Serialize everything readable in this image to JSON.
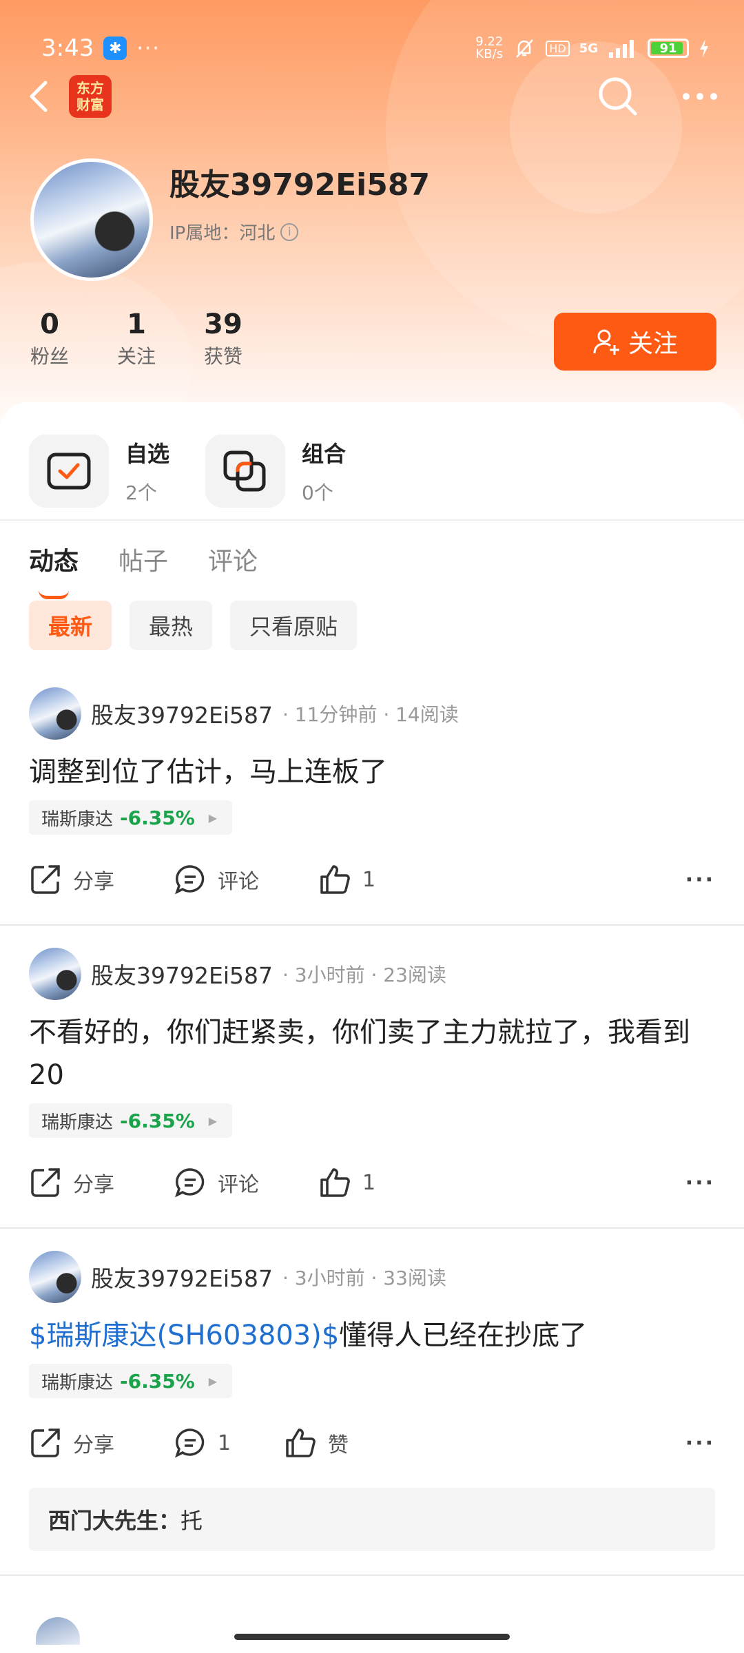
{
  "status_bar": {
    "time": "3:43",
    "bluetooth_badge": "✱",
    "more": "···",
    "net_speed_value": "9.22",
    "net_speed_unit": "KB/s",
    "hd": "HD",
    "network": "5G",
    "battery": "91"
  },
  "app": {
    "logo_text": "东方\n财富",
    "accent": "#ff5a14"
  },
  "profile": {
    "username": "股友39792Ei587",
    "ip_label": "IP属地：河北",
    "stats": [
      {
        "num": "0",
        "label": "粉丝"
      },
      {
        "num": "1",
        "label": "关注"
      },
      {
        "num": "39",
        "label": "获赞"
      }
    ],
    "follow_label": "关注"
  },
  "shortcuts": [
    {
      "title": "自选",
      "sub": "2个"
    },
    {
      "title": "组合",
      "sub": "0个"
    }
  ],
  "tabs": [
    "动态",
    "帖子",
    "评论"
  ],
  "filters": [
    "最新",
    "最热",
    "只看原贴"
  ],
  "posts": [
    {
      "user": "股友39792Ei587",
      "meta": "· 11分钟前 · 14阅读",
      "text_link": "",
      "text": "调整到位了估计，马上连板了",
      "stock": {
        "name": "瑞斯康达",
        "change": "-6.35%"
      },
      "share": "分享",
      "comment": "评论",
      "like": "1"
    },
    {
      "user": "股友39792Ei587",
      "meta": "· 3小时前 · 23阅读",
      "text_link": "",
      "text": "不看好的，你们赶紧卖，你们卖了主力就拉了，我看到20",
      "stock": {
        "name": "瑞斯康达",
        "change": "-6.35%"
      },
      "share": "分享",
      "comment": "评论",
      "like": "1"
    },
    {
      "user": "股友39792Ei587",
      "meta": "· 3小时前 · 33阅读",
      "text_link": "$瑞斯康达(SH603803)$",
      "text": "懂得人已经在抄底了",
      "stock": {
        "name": "瑞斯康达",
        "change": "-6.35%"
      },
      "share": "分享",
      "comment": "1",
      "like": "赞",
      "comment_preview": {
        "author": "西门大先生：",
        "text": "托"
      }
    }
  ]
}
